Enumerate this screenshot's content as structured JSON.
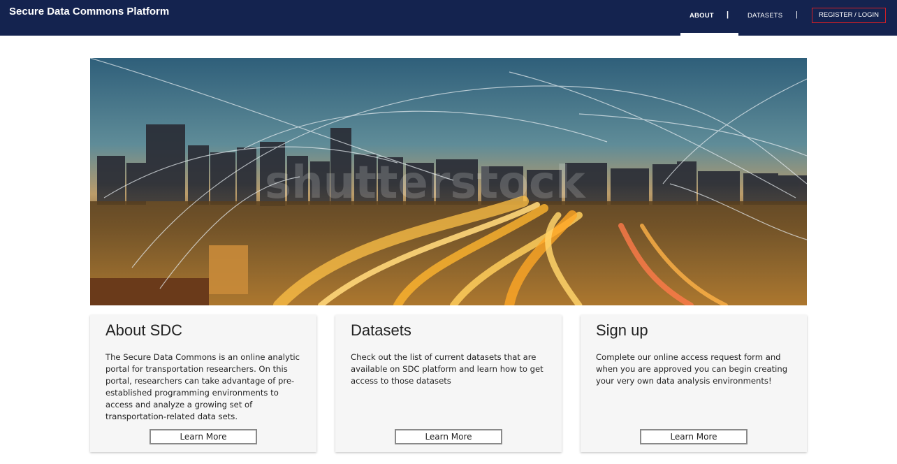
{
  "navbar": {
    "brand": "Secure Data Commons Platform",
    "items": [
      {
        "label": "ABOUT",
        "active": true
      },
      {
        "label": "DATASETS",
        "active": false
      },
      {
        "label": "REGISTER / LOGIN",
        "active": false
      }
    ],
    "separator": "|",
    "background_color": "#14234f",
    "register_border_color": "#d21f26"
  },
  "hero": {
    "watermark": "shutterstock"
  },
  "cards": [
    {
      "title": "About SDC",
      "text": "The Secure Data Commons is an online analytic portal for transportation researchers. On this portal, researchers can take advantage of pre-established programming environments to access and analyze a growing set of transportation-related data sets.",
      "button": "Learn More"
    },
    {
      "title": "Datasets",
      "text": "Check out the list of current datasets that are available on SDC platform and learn how to get access to those datasets",
      "button": "Learn More"
    },
    {
      "title": "Sign up",
      "text": "Complete our online access request form and when you are approved you can begin creating your very own data analysis environments!",
      "button": "Learn More"
    }
  ]
}
